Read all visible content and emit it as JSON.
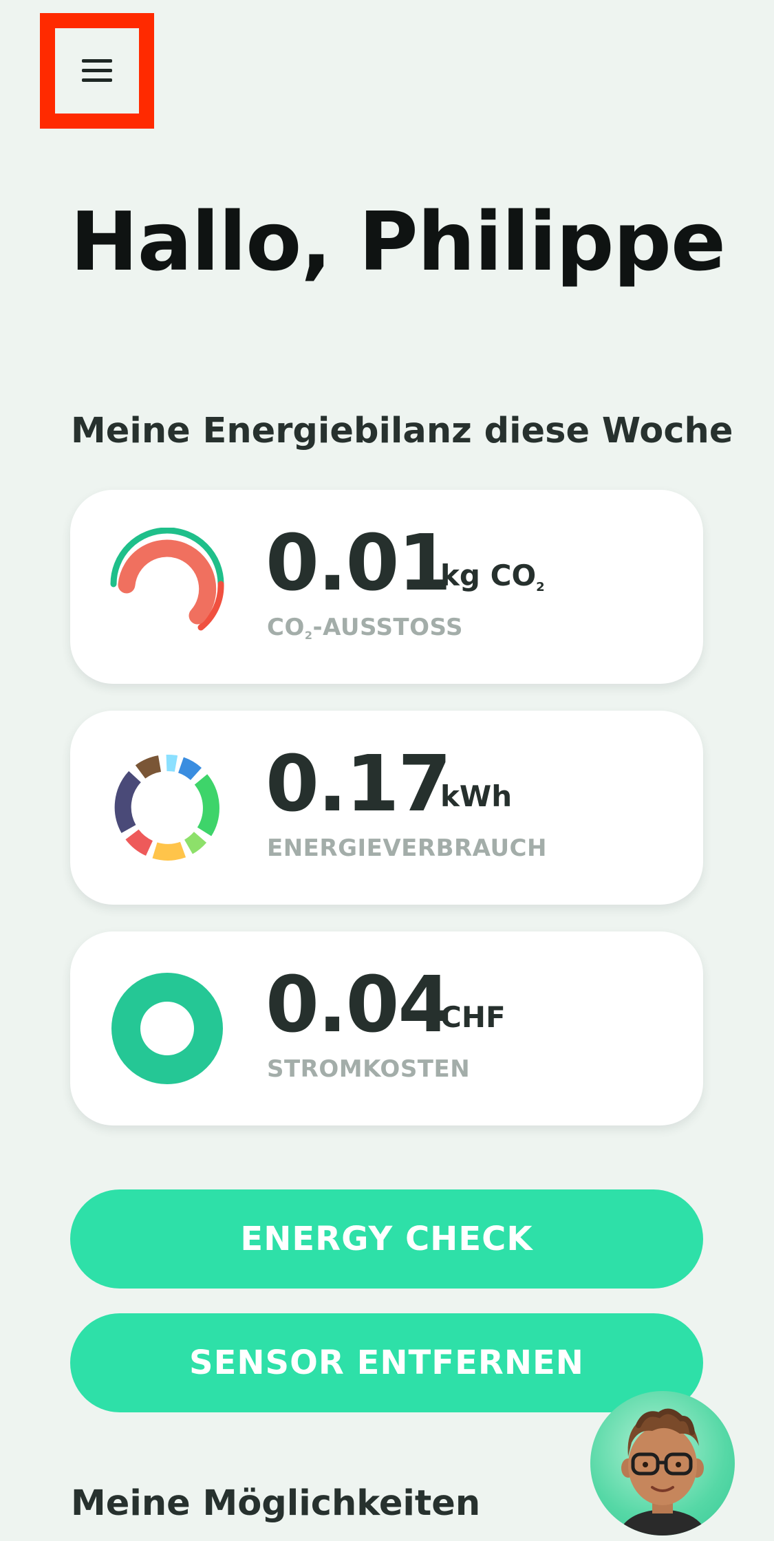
{
  "header": {
    "menu_icon": "hamburger-menu-icon",
    "highlight_color": "#ff2a00"
  },
  "greeting": "Hallo, Philippe",
  "energy_section": {
    "title": "Meine Energiebilanz diese Woche",
    "cards": [
      {
        "value": "0.01",
        "unit_main": "kg CO",
        "unit_sub": "2",
        "label_main": "CO",
        "label_sub": "2",
        "label_rest": "-AUSSTOSS",
        "icon": "co2-gauge-icon"
      },
      {
        "value": "0.17",
        "unit": "kWh",
        "label": "ENERGIEVERBRAUCH",
        "icon": "energy-segments-donut-icon"
      },
      {
        "value": "0.04",
        "unit": "CHF",
        "label": "STROMKOSTEN",
        "icon": "cost-donut-icon"
      }
    ]
  },
  "buttons": {
    "energy_check": "ENERGY CHECK",
    "remove_sensor": "SENSOR ENTFERNEN"
  },
  "options_section": {
    "title": "Meine Möglichkeiten"
  },
  "assistant": {
    "icon": "assistant-avatar-icon"
  },
  "colors": {
    "accent": "#2ee0a8",
    "background": "#eef4f0",
    "gauge_green": "#1fbf8a",
    "gauge_red": "#f0705f"
  }
}
